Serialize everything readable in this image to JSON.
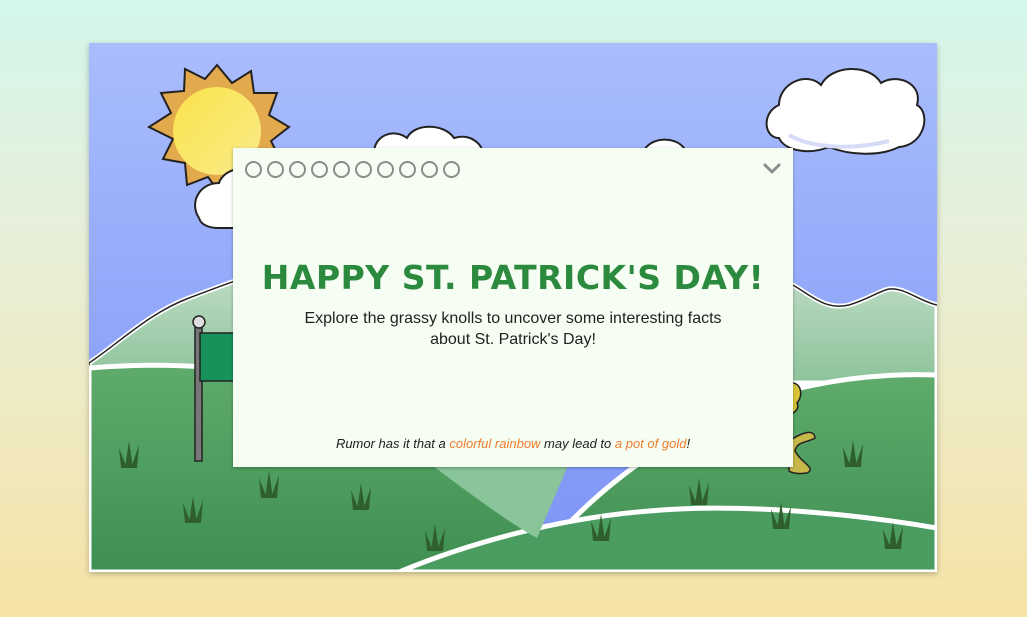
{
  "modal": {
    "title": "HAPPY ST. PATRICK'S DAY!",
    "subtitle": "Explore the grassy knolls to uncover some interesting facts about St. Patrick's Day!",
    "rumor_prefix": "Rumor has it that a ",
    "rumor_link1": "colorful rainbow",
    "rumor_middle": " may lead to ",
    "rumor_link2": "a pot of gold",
    "rumor_suffix": "!",
    "pager_count": 10,
    "collapse_icon": "chevron-down-icon"
  },
  "colors": {
    "sky": "#8fa6f8",
    "grass": "#4e9a5e",
    "title": "#2b8a3e",
    "link": "#ef7d2c",
    "modal_bg": "#f6fdf2",
    "flag": "#17935a"
  }
}
